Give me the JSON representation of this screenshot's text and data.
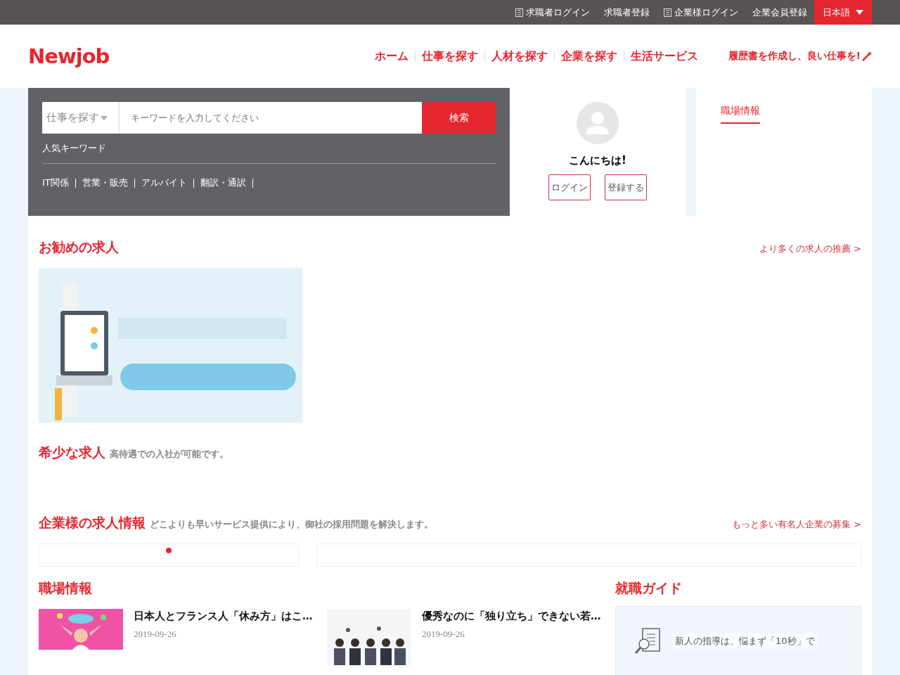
{
  "top_bar": {
    "links": [
      {
        "label": "求職者ログイン",
        "kind": "icon"
      },
      {
        "label": "求職者登録",
        "kind": "plain"
      },
      {
        "label": "企業様ログイン",
        "kind": "icon"
      },
      {
        "label": "企業会員登録",
        "kind": "plain"
      }
    ],
    "language": "日本語"
  },
  "header": {
    "logo": "Newjob",
    "nav": [
      "ホーム",
      "仕事を探す",
      "人材を探す",
      "企業を探す",
      "生活サービス"
    ],
    "promo": "履歴書を作成し、良い仕事を!"
  },
  "search": {
    "category": "仕事を探す",
    "placeholder": "キーワードを入力してください",
    "button": "検索",
    "popular_title": "人気キーワード",
    "keywords": [
      "IT関係",
      "営業・販売",
      "アルバイト",
      "翻訳・通訳"
    ]
  },
  "user_panel": {
    "greeting": "こんにちは!",
    "buttons": [
      "ログイン",
      "登録する"
    ]
  },
  "side_tabs": [
    {
      "label": "職場情報",
      "selected": true
    }
  ],
  "recommended": {
    "title": "お勧めの求人",
    "more": "より多くの求人の推薦 >"
  },
  "rare": {
    "title": "希少な求人",
    "subtitle": "高待遇での入社が可能です。"
  },
  "company": {
    "title": "企業様の求人情報",
    "subtitle": "どこよりも早いサービス提供により、御社の採用問題を解決します。",
    "more": "もっと多い有名人企業の募集 >",
    "carousel_dots": [
      {
        "selected": true
      }
    ]
  },
  "workplace": {
    "title": "職場情報",
    "articles": [
      {
        "title": "日本人とフランス人「休み方」はこ…",
        "date": "2019-09-26",
        "kind": "pink"
      },
      {
        "title": "優秀なのに「独り立ち」できない若…",
        "date": "2019-09-26",
        "kind": "people"
      }
    ]
  },
  "guide": {
    "title": "就職ガイド",
    "item": "新人の指導は、悩まず「10秒」で"
  }
}
